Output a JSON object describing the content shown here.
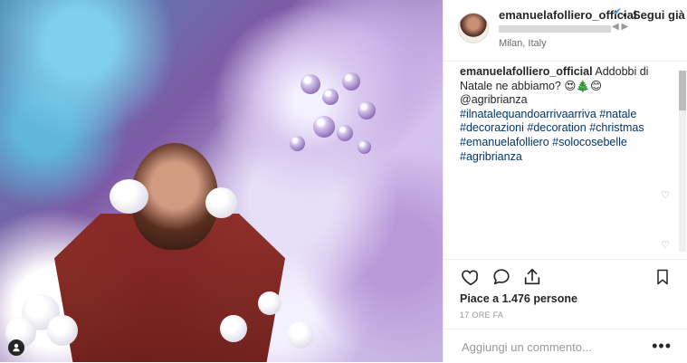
{
  "post": {
    "username": "emanuelafolliero_official",
    "location": "Milan, Italy",
    "follow_label": "Segui già",
    "caption": {
      "username": "emanuelafolliero_official",
      "text": "Addobbi di Natale ne abbiamo? 😍🎄😊 @agribrianza",
      "hashtags": [
        "#ilnatalequandoarrivaarriva",
        "#natale",
        "#decorazioni",
        "#decoration",
        "#christmas",
        "#emanuelafolliero",
        "#solocosebelle",
        "#agribrianza"
      ]
    },
    "likes_text": "Piace a 1.476 persone",
    "timestamp": "17 ORE FA",
    "comment_placeholder": "Aggiungi un commento..."
  },
  "icons": {
    "like": "heart-icon",
    "comment": "speech-bubble-icon",
    "share": "share-icon",
    "save": "bookmark-icon",
    "verified": "verified-icon",
    "more": "more-icon",
    "user_tag": "user-tag-icon"
  },
  "colors": {
    "hashtag": "#003569",
    "verified": "#3897f0",
    "text": "#262626",
    "muted": "#999999"
  }
}
